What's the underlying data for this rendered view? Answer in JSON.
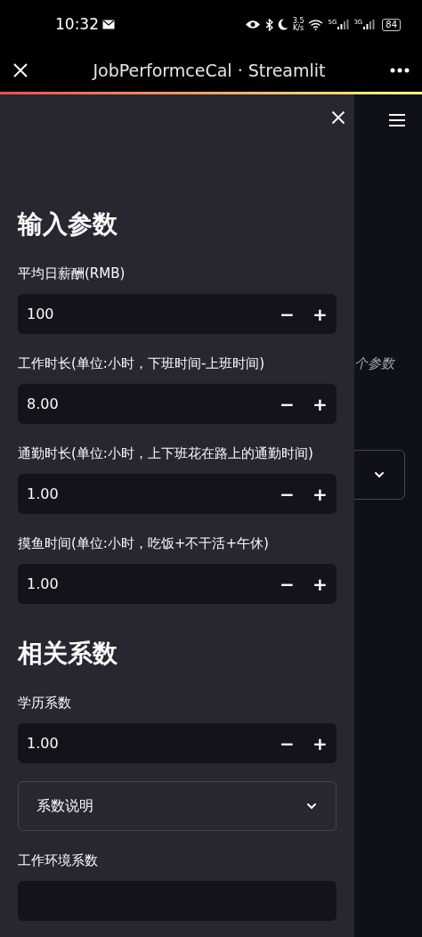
{
  "status_bar": {
    "time": "10:32",
    "speed_value": "3.5",
    "speed_unit": "K/s",
    "network_1": "5G",
    "network_2": "3G",
    "battery": "84"
  },
  "browser": {
    "title": "JobPerformceCal · Streamlit"
  },
  "main": {
    "partial_text": "个参数"
  },
  "sidebar": {
    "sections": [
      {
        "kind": "heading",
        "text": "输入参数"
      },
      {
        "kind": "number",
        "label": "平均日薪酬(RMB)",
        "value": "100"
      },
      {
        "kind": "number",
        "label": "工作时长(单位:小时，下班时间-上班时间)",
        "value": "8.00"
      },
      {
        "kind": "number",
        "label": "通勤时长(单位:小时，上下班花在路上的通勤时间)",
        "value": "1.00"
      },
      {
        "kind": "number",
        "label": "摸鱼时间(单位:小时，吃饭+不干活+午休)",
        "value": "1.00"
      },
      {
        "kind": "heading",
        "text": "相关系数"
      },
      {
        "kind": "number",
        "label": "学历系数",
        "value": "1.00"
      },
      {
        "kind": "expander",
        "label": "系数说明",
        "expanded": false
      },
      {
        "kind": "number",
        "label": "工作环境系数"
      }
    ]
  },
  "minus": "−",
  "plus": "+"
}
